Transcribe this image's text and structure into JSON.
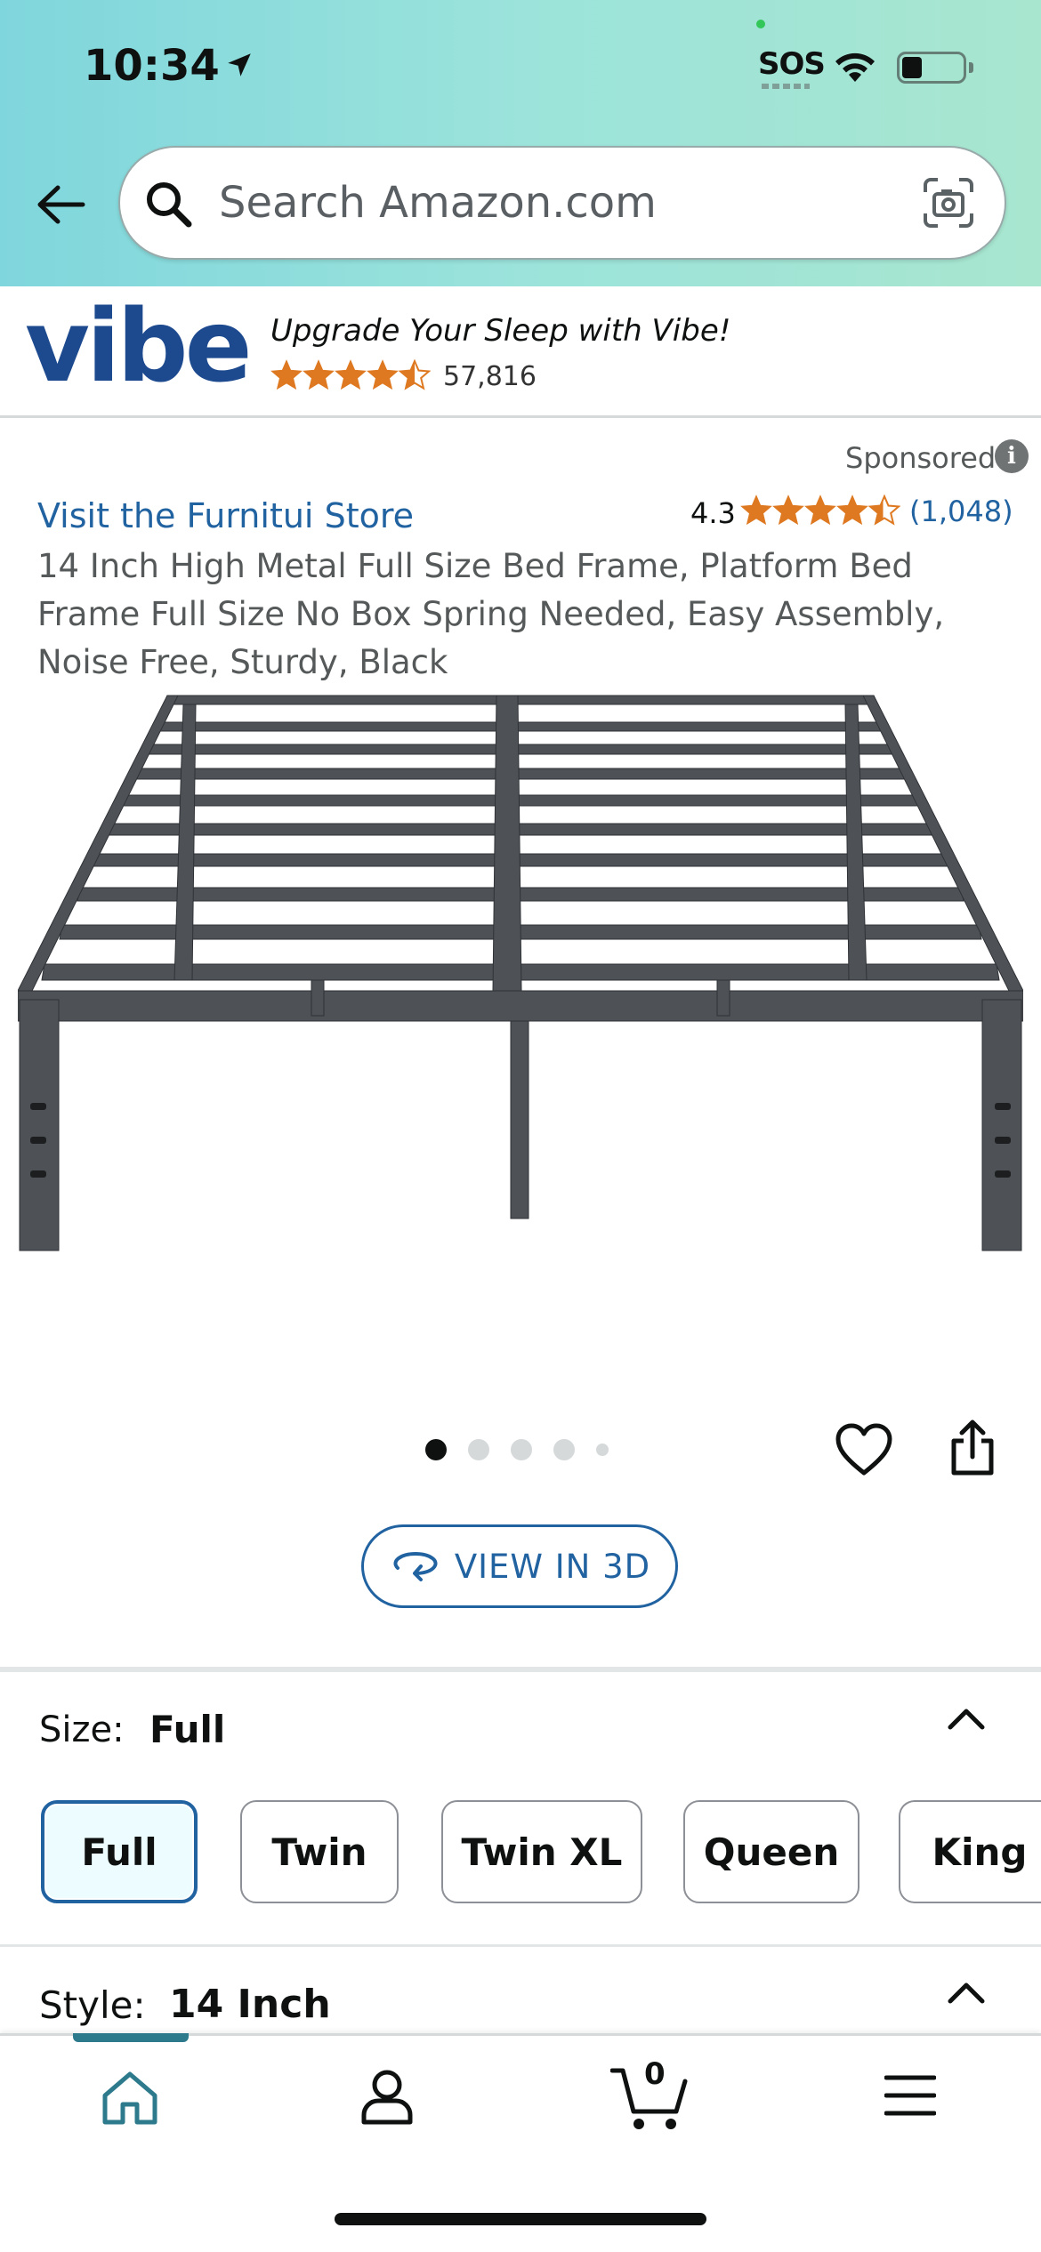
{
  "status_bar": {
    "time": "10:34",
    "sos": "SOS"
  },
  "search": {
    "placeholder": "Search Amazon.com"
  },
  "ad": {
    "brand": "vibe",
    "tagline": "Upgrade Your Sleep with Vibe!",
    "rating_count": "57,816",
    "stars": 4.5
  },
  "sponsored": "Sponsored",
  "product": {
    "store_link": "Visit the Furnitui Store",
    "rating": "4.3",
    "rating_count": "(1,048)",
    "title": "14 Inch High Metal Full Size Bed Frame, Platform Bed Frame Full Size No Box Spring Needed, Easy Assembly, Noise Free, Sturdy, Black",
    "image_count": 5,
    "active_image": 1,
    "view_3d_label": "VIEW IN 3D"
  },
  "size": {
    "label": "Size:",
    "value": "Full",
    "options": [
      "Full",
      "Twin",
      "Twin XL",
      "Queen",
      "King"
    ]
  },
  "style": {
    "label": "Style:",
    "value": "14 Inch"
  },
  "nav": {
    "cart_count": "0"
  },
  "colors": {
    "link": "#2162a1",
    "star": "#de7921",
    "nav_active": "#2c7a8c"
  }
}
